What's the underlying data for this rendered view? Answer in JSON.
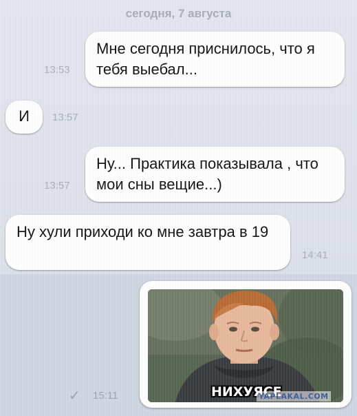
{
  "date_header": "сегодня, 7 августа",
  "messages": [
    {
      "direction": "outgoing",
      "text": "Мне сегодня приснилось, что я тебя выебал...",
      "time": "13:53"
    },
    {
      "direction": "incoming",
      "text": "И",
      "time": "13:57"
    },
    {
      "direction": "outgoing",
      "text": "Ну... Практика показывала , что мои сны вещие...)",
      "time": "13:57"
    },
    {
      "direction": "incoming",
      "text": "Ну хули приходи ко мне завтра в 19",
      "time": "14:41"
    }
  ],
  "photo_message": {
    "direction": "outgoing",
    "caption": "НИХУЯСЕ",
    "watermark": "YAPLAKAL.COM",
    "time": "15:11",
    "status_icon": "check-icon"
  },
  "colors": {
    "background": "#e0e3eb",
    "bubble": "#ffffff",
    "selected_row": "#cfd6e1",
    "meta_text": "#a9aeba"
  }
}
